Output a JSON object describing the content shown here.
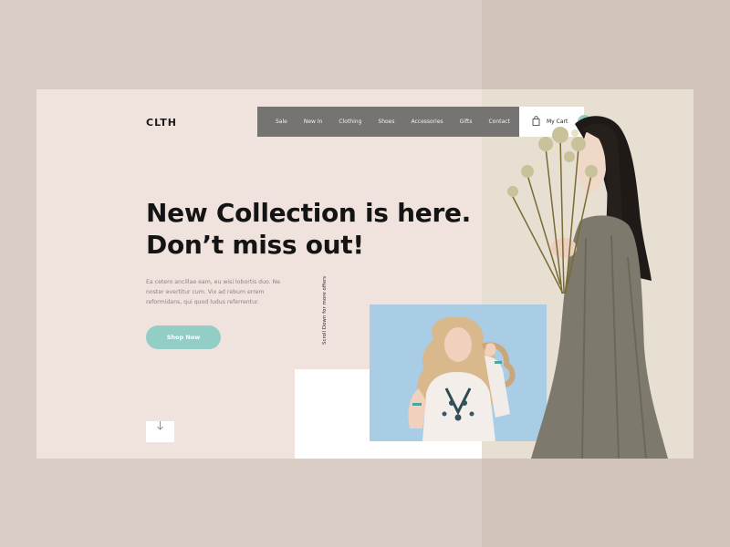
{
  "logo": "CLTH",
  "nav": {
    "items": [
      "Sale",
      "New In",
      "Clothing",
      "Shoes",
      "Accessories",
      "Gifts",
      "Contact"
    ]
  },
  "cart": {
    "label": "My Cart",
    "arrow": "›"
  },
  "hero": {
    "headline_line1": "New Collection is here.",
    "headline_line2": "Don’t miss out!",
    "body": "Ea cetero ancillae eam, eu wisi lobortis duo. Ne noster evertitur cum. Vix ad rebum errem reformidans, qui quod ludus referrentur.",
    "button": "Shop Now",
    "scroll_text": "Scroll Down for more offers"
  },
  "icons": {
    "cart": "shopping-bag-icon",
    "scroll": "arrow-down-icon",
    "next": "chevron-right-icon"
  },
  "colors": {
    "page_bg": "#dacdc6",
    "card_bg": "#f0e3de",
    "nav_bg": "#767472",
    "accent": "#92cdc6"
  }
}
